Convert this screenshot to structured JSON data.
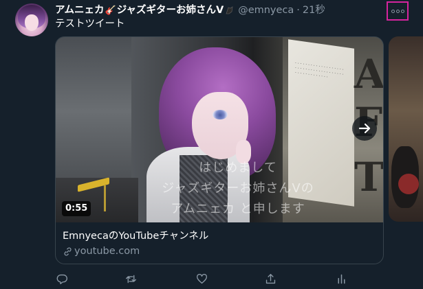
{
  "tweet": {
    "display_name": "アムニェカ",
    "name_suffix": "ジャズギターお姉さんV",
    "handle": "@emnyeca",
    "separator": "·",
    "timestamp": "21秒",
    "text": "テストツイート"
  },
  "card": {
    "duration": "0:55",
    "subtitles": [
      "はじめまして",
      "ジャズギターお姉さんVの",
      "アムニェカ と申します"
    ],
    "title": "EmnyecaのYouTubeチャンネル",
    "domain": "youtube.com"
  },
  "icons": {
    "more": "more-horizontal-icon",
    "next": "arrow-right-icon",
    "link": "link-icon",
    "reply": "reply-icon",
    "retweet": "retweet-icon",
    "like": "heart-icon",
    "share": "share-icon",
    "analytics": "analytics-icon"
  },
  "colors": {
    "background": "#15202b",
    "secondary_text": "#8b98a5",
    "border": "#38444d",
    "highlight_border": "#d6249f"
  }
}
